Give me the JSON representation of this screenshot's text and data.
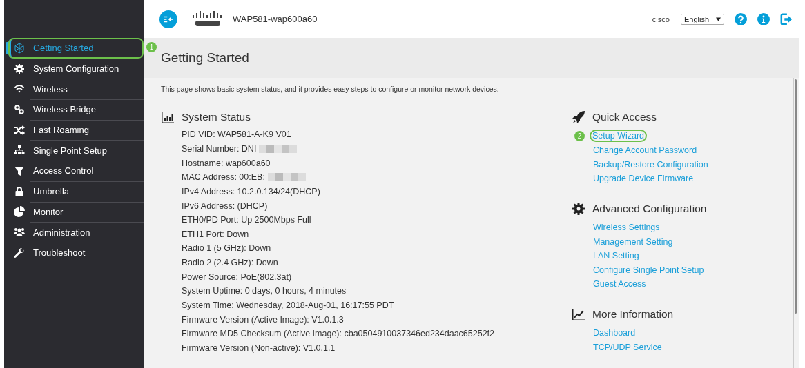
{
  "header": {
    "device_name": "WAP581-wap600a60",
    "user": "cisco",
    "language": "English"
  },
  "sidebar": {
    "items": [
      {
        "label": "Getting Started",
        "selected": true,
        "highlighted": true,
        "callout": "1"
      },
      {
        "label": "System Configuration",
        "selected": false,
        "highlighted": false
      },
      {
        "label": "Wireless",
        "selected": false,
        "highlighted": false
      },
      {
        "label": "Wireless Bridge",
        "selected": false,
        "highlighted": false
      },
      {
        "label": "Fast Roaming",
        "selected": false,
        "highlighted": false
      },
      {
        "label": "Single Point Setup",
        "selected": false,
        "highlighted": false
      },
      {
        "label": "Access Control",
        "selected": false,
        "highlighted": false
      },
      {
        "label": "Umbrella",
        "selected": false,
        "highlighted": false
      },
      {
        "label": "Monitor",
        "selected": false,
        "highlighted": false
      },
      {
        "label": "Administration",
        "selected": false,
        "highlighted": false
      },
      {
        "label": "Troubleshoot",
        "selected": false,
        "highlighted": false
      }
    ]
  },
  "page": {
    "title": "Getting Started",
    "intro": "This page shows basic system status, and it provides easy steps to configure or monitor network devices."
  },
  "system_status": {
    "title": "System Status",
    "lines": [
      {
        "text": "PID VID: WAP581-A-K9 V01",
        "redacted": false
      },
      {
        "text": "Serial Number: DNI",
        "redacted": true
      },
      {
        "text": "Hostname: wap600a60",
        "redacted": false
      },
      {
        "text": "MAC Address: 00:EB:",
        "redacted": true
      },
      {
        "text": "IPv4 Address: 10.2.0.134/24(DHCP)",
        "redacted": false
      },
      {
        "text": "IPv6 Address: (DHCP)",
        "redacted": false
      },
      {
        "text": "ETH0/PD Port: Up 2500Mbps Full",
        "redacted": false
      },
      {
        "text": "ETH1 Port: Down",
        "redacted": false
      },
      {
        "text": "Radio 1 (5 GHz): Down",
        "redacted": false
      },
      {
        "text": "Radio 2 (2.4 GHz): Down",
        "redacted": false
      },
      {
        "text": "Power Source: PoE(802.3at)",
        "redacted": false
      },
      {
        "text": "System Uptime: 0 days, 0 hours, 4 minutes",
        "redacted": false
      },
      {
        "text": "System Time: Wednesday, 2018-Aug-01, 16:17:55 PDT",
        "redacted": false
      },
      {
        "text": "Firmware Version (Active Image): V1.0.1.3",
        "redacted": false
      },
      {
        "text": "Firmware MD5 Checksum (Active Image): cba0504910037346ed234daac65252f2",
        "redacted": false
      },
      {
        "text": "Firmware Version (Non-active): V1.0.1.1",
        "redacted": false
      }
    ]
  },
  "link_sections": [
    {
      "title": "Quick Access",
      "links": [
        {
          "label": "Setup Wizard",
          "highlighted": true,
          "callout": "2"
        },
        {
          "label": "Change Account Password",
          "highlighted": false
        },
        {
          "label": "Backup/Restore Configuration",
          "highlighted": false
        },
        {
          "label": "Upgrade Device Firmware",
          "highlighted": false
        }
      ]
    },
    {
      "title": "Advanced Configuration",
      "links": [
        {
          "label": "Wireless Settings",
          "highlighted": false
        },
        {
          "label": "Management Setting",
          "highlighted": false
        },
        {
          "label": "LAN Setting",
          "highlighted": false
        },
        {
          "label": "Configure Single Point Setup",
          "highlighted": false
        },
        {
          "label": "Guest Access",
          "highlighted": false
        }
      ]
    },
    {
      "title": "More Information",
      "links": [
        {
          "label": "Dashboard",
          "highlighted": false
        },
        {
          "label": "TCP/UDP Service",
          "highlighted": false
        }
      ]
    }
  ]
}
